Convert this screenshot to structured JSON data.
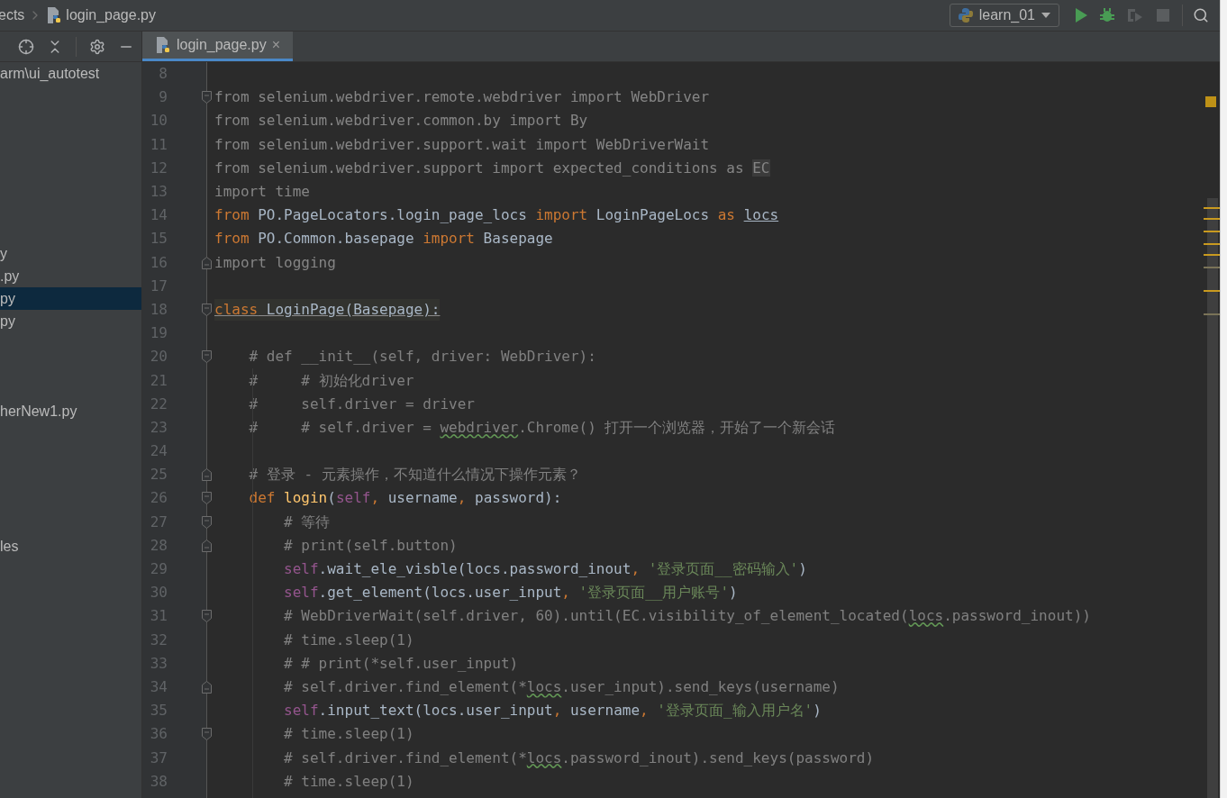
{
  "breadcrumb": {
    "items": [
      "ects",
      "login_page.py"
    ]
  },
  "run_config": {
    "label": "learn_01"
  },
  "project_panel": {
    "items": [
      {
        "text": "arm\\ui_autotest",
        "selected": false
      },
      {
        "text": "y",
        "selected": false
      },
      {
        "text": ".py",
        "selected": false
      },
      {
        "text": "py",
        "selected": true
      },
      {
        "text": "py",
        "selected": false
      },
      {
        "text": "herNew1.py",
        "selected": false
      },
      {
        "text": "les",
        "selected": false
      }
    ]
  },
  "tabs": [
    {
      "label": "login_page.py",
      "selected": true,
      "close": "×"
    }
  ],
  "editor": {
    "lines": [
      {
        "number": "8"
      },
      {
        "number": "9",
        "fold_start": true,
        "tokens": [
          {
            "kind": "dim",
            "text": "from selenium.webdriver.remote.webdriver import WebDriver"
          }
        ]
      },
      {
        "number": "10",
        "tokens": [
          {
            "kind": "dim",
            "text": "from selenium.webdriver.common.by import By"
          }
        ]
      },
      {
        "number": "11",
        "tokens": [
          {
            "kind": "dim",
            "text": "from selenium.webdriver.support.wait import WebDriverWait"
          }
        ]
      },
      {
        "number": "12",
        "tokens": [
          {
            "kind": "dim",
            "text": "from selenium.webdriver.support import expected_conditions as "
          },
          {
            "kind": "box",
            "text": "EC"
          }
        ]
      },
      {
        "number": "13",
        "tokens": [
          {
            "kind": "dim",
            "text": "import time"
          }
        ]
      },
      {
        "number": "14",
        "tokens": [
          {
            "kind": "kw",
            "text": "from"
          },
          {
            "kind": "plain",
            "text": " PO.PageLocators.login_page_locs "
          },
          {
            "kind": "kw",
            "text": "import"
          },
          {
            "kind": "plain",
            "text": " LoginPageLocs "
          },
          {
            "kind": "kw",
            "text": "as "
          },
          {
            "kind": "under",
            "text": "locs"
          }
        ]
      },
      {
        "number": "15",
        "tokens": [
          {
            "kind": "kw",
            "text": "from"
          },
          {
            "kind": "plain",
            "text": " PO.Common.basepage "
          },
          {
            "kind": "kw",
            "text": "import"
          },
          {
            "kind": "plain",
            "text": " Basepage"
          }
        ]
      },
      {
        "number": "16",
        "fold_end": true,
        "tokens": [
          {
            "kind": "dim",
            "text": "import logging"
          }
        ]
      },
      {
        "number": "17"
      },
      {
        "number": "18",
        "fold_start": true,
        "warned": true,
        "tokens": [
          {
            "kind": "kw",
            "text": "class"
          },
          {
            "kind": "plain",
            "text": " LoginPage(Basepage):"
          }
        ]
      },
      {
        "number": "19"
      },
      {
        "number": "20",
        "fold_start": true,
        "tokens": [
          {
            "kind": "comment",
            "text": "    # def __init__(self, driver: WebDriver):"
          }
        ]
      },
      {
        "number": "21",
        "tokens": [
          {
            "kind": "comment",
            "text": "    #     # 初始化driver"
          }
        ]
      },
      {
        "number": "22",
        "tokens": [
          {
            "kind": "comment",
            "text": "    #     self.driver = driver"
          }
        ]
      },
      {
        "number": "23",
        "tokens": [
          {
            "kind": "comment",
            "text": "    #     # self.driver = "
          },
          {
            "kind": "wavy",
            "text": "webdriver"
          },
          {
            "kind": "comment",
            "text": ".Chrome() 打开一个浏览器，开始了一个新会话"
          }
        ]
      },
      {
        "number": "24"
      },
      {
        "number": "25",
        "fold_end": true,
        "tokens": [
          {
            "kind": "comment",
            "text": "    # 登录 - 元素操作，不知道什么情况下操作元素？"
          }
        ]
      },
      {
        "number": "26",
        "fold_start": true,
        "tokens": [
          {
            "kind": "kw",
            "text": "    def "
          },
          {
            "kind": "fn",
            "text": "login"
          },
          {
            "kind": "plain",
            "text": "("
          },
          {
            "kind": "self",
            "text": "self"
          },
          {
            "kind": "kw",
            "text": ","
          },
          {
            "kind": "plain",
            "text": " username"
          },
          {
            "kind": "kw",
            "text": ","
          },
          {
            "kind": "plain",
            "text": " password):"
          }
        ]
      },
      {
        "number": "27",
        "fold_start": true,
        "tokens": [
          {
            "kind": "comment",
            "text": "        # 等待"
          }
        ]
      },
      {
        "number": "28",
        "fold_end": true,
        "tokens": [
          {
            "kind": "comment",
            "text": "        # print(self.button)"
          }
        ]
      },
      {
        "number": "29",
        "tokens": [
          {
            "kind": "self",
            "text": "        self"
          },
          {
            "kind": "plain",
            "text": ".wait_ele_visble(locs.password_inout"
          },
          {
            "kind": "kw",
            "text": ", "
          },
          {
            "kind": "str",
            "text": "'登录页面__密码输入'"
          },
          {
            "kind": "plain",
            "text": ")"
          }
        ]
      },
      {
        "number": "30",
        "tokens": [
          {
            "kind": "self",
            "text": "        self"
          },
          {
            "kind": "plain",
            "text": ".get_element(locs.user_input"
          },
          {
            "kind": "kw",
            "text": ", "
          },
          {
            "kind": "str",
            "text": "'登录页面__用户账号'"
          },
          {
            "kind": "plain",
            "text": ")"
          }
        ]
      },
      {
        "number": "31",
        "fold_start": true,
        "tokens": [
          {
            "kind": "comment",
            "text": "        # WebDriverWait(self.driver, 60).until(EC.visibility_of_element_located("
          },
          {
            "kind": "wavy",
            "text": "locs"
          },
          {
            "kind": "comment",
            "text": ".password_inout))"
          }
        ]
      },
      {
        "number": "32",
        "tokens": [
          {
            "kind": "comment",
            "text": "        # time.sleep(1)"
          }
        ]
      },
      {
        "number": "33",
        "tokens": [
          {
            "kind": "comment",
            "text": "        # # print(*self.user_input)"
          }
        ]
      },
      {
        "number": "34",
        "fold_end": true,
        "tokens": [
          {
            "kind": "comment",
            "text": "        # self.driver.find_element(*"
          },
          {
            "kind": "wavy",
            "text": "locs"
          },
          {
            "kind": "comment",
            "text": ".user_input).send_keys(username)"
          }
        ]
      },
      {
        "number": "35",
        "tokens": [
          {
            "kind": "self",
            "text": "        self"
          },
          {
            "kind": "plain",
            "text": ".input_text(locs.user_input"
          },
          {
            "kind": "kw",
            "text": ","
          },
          {
            "kind": "plain",
            "text": " username"
          },
          {
            "kind": "kw",
            "text": ", "
          },
          {
            "kind": "str",
            "text": "'登录页面_输入用户名'"
          },
          {
            "kind": "plain",
            "text": ")"
          }
        ]
      },
      {
        "number": "36",
        "fold_start": true,
        "tokens": [
          {
            "kind": "comment",
            "text": "        # time.sleep(1)"
          }
        ]
      },
      {
        "number": "37",
        "tokens": [
          {
            "kind": "comment",
            "text": "        # self.driver.find_element(*"
          },
          {
            "kind": "wavy",
            "text": "locs"
          },
          {
            "kind": "comment",
            "text": ".password_inout).send_keys(password)"
          }
        ]
      },
      {
        "number": "38",
        "tokens": [
          {
            "kind": "comment",
            "text": "        # time.sleep(1)"
          }
        ]
      }
    ]
  }
}
